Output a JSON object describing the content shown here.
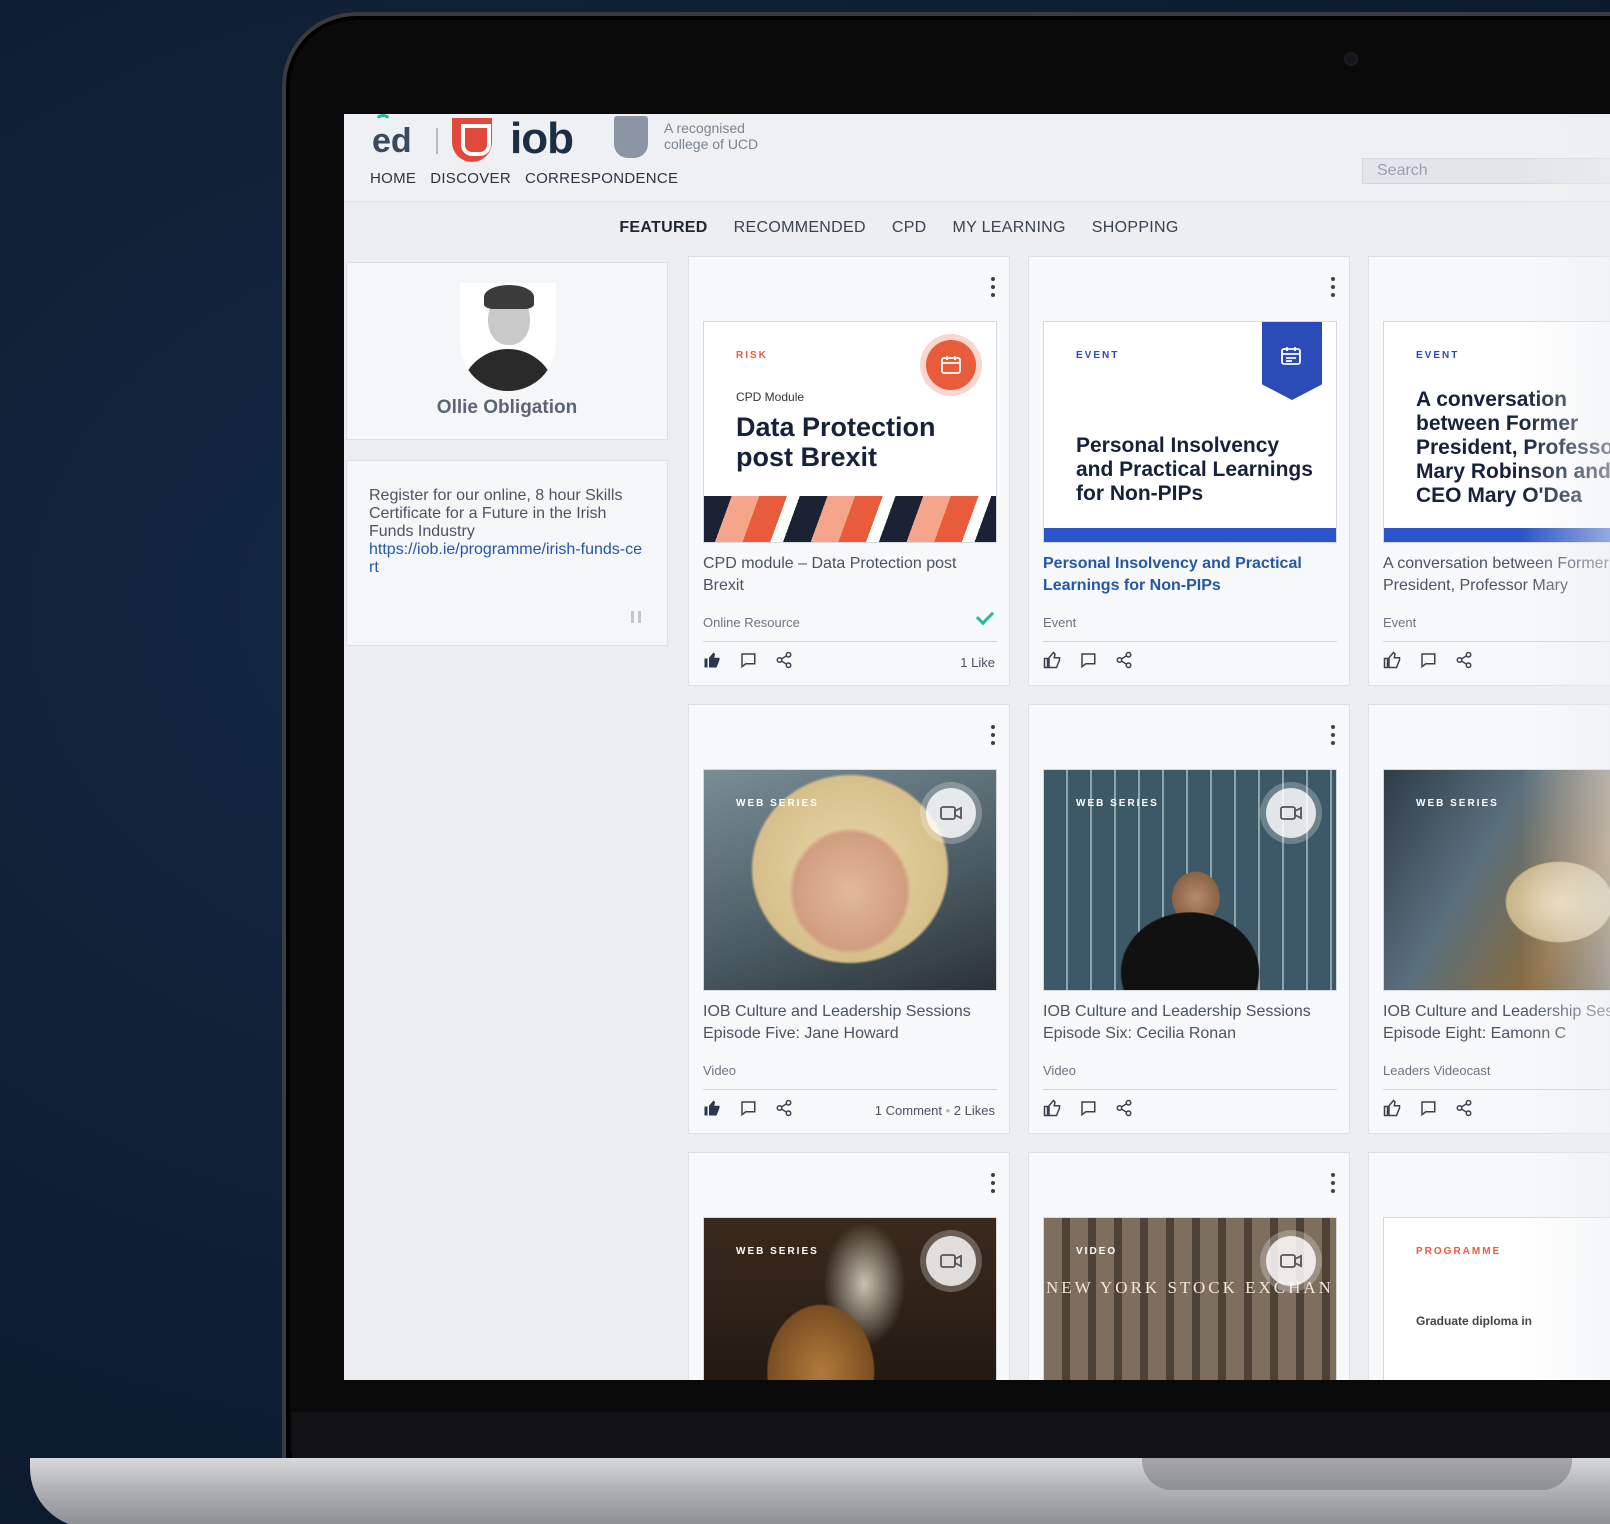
{
  "brand": {
    "logo_ed": "ed",
    "logo_iob": "iob",
    "ucd_tagline": "A recognised college of UCD"
  },
  "topnav": [
    "HOME",
    "DISCOVER",
    "CORRESPONDENCE"
  ],
  "search": {
    "placeholder": "Search"
  },
  "tabs": [
    {
      "label": "FEATURED",
      "active": true
    },
    {
      "label": "RECOMMENDED",
      "active": false
    },
    {
      "label": "CPD",
      "active": false
    },
    {
      "label": "MY LEARNING",
      "active": false
    },
    {
      "label": "SHOPPING",
      "active": false
    }
  ],
  "profile": {
    "name": "Ollie Obligation"
  },
  "promo": {
    "text": "Register for our online, 8 hour Skills Certificate for a Future in the Irish Funds Industry",
    "link": "https://iob.ie/programme/irish-funds-cert"
  },
  "cards": [
    {
      "tag": "RISK",
      "thumb_sub": "CPD Module",
      "thumb_title": "Data Protection post Brexit",
      "title": "CPD module – Data Protection post Brexit",
      "type": "Online Resource",
      "completed": true,
      "liked": true,
      "likes_text": "1 Like"
    },
    {
      "tag": "EVENT",
      "thumb_title": "Personal Insolvency and Practical Learnings for Non-PIPs",
      "title": "Personal Insolvency and Practical Learnings for Non-PIPs",
      "type": "Event"
    },
    {
      "tag": "EVENT",
      "thumb_title": "A conversation between Former President, Professor Mary Robinson and CEO Mary O'Dea",
      "title": "A conversation between Former President, Professor Mary",
      "type": "Event"
    },
    {
      "tag": "WEB SERIES",
      "title": "IOB Culture and Leadership Sessions Episode Five: Jane Howard",
      "type": "Video",
      "liked": true,
      "comments_text": "1 Comment",
      "likes_text": "2 Likes"
    },
    {
      "tag": "WEB SERIES",
      "title": "IOB Culture and Leadership Sessions Episode Six: Cecilia Ronan",
      "type": "Video"
    },
    {
      "tag": "WEB SERIES",
      "title": "IOB Culture and Leadership Sessions Episode Eight: Eamonn C",
      "type": "Leaders Videocast"
    },
    {
      "tag": "WEB SERIES"
    },
    {
      "tag": "VIDEO",
      "thumb_text": "NEW YORK STOCK EXCHAN"
    },
    {
      "tag": "PROGRAMME",
      "thumb_sub": "Graduate diploma in"
    }
  ],
  "colors": {
    "accent_orange": "#e85c3c",
    "accent_blue": "#2b55c8",
    "link_blue": "#2557a7",
    "teal_check": "#2fb6a0"
  }
}
